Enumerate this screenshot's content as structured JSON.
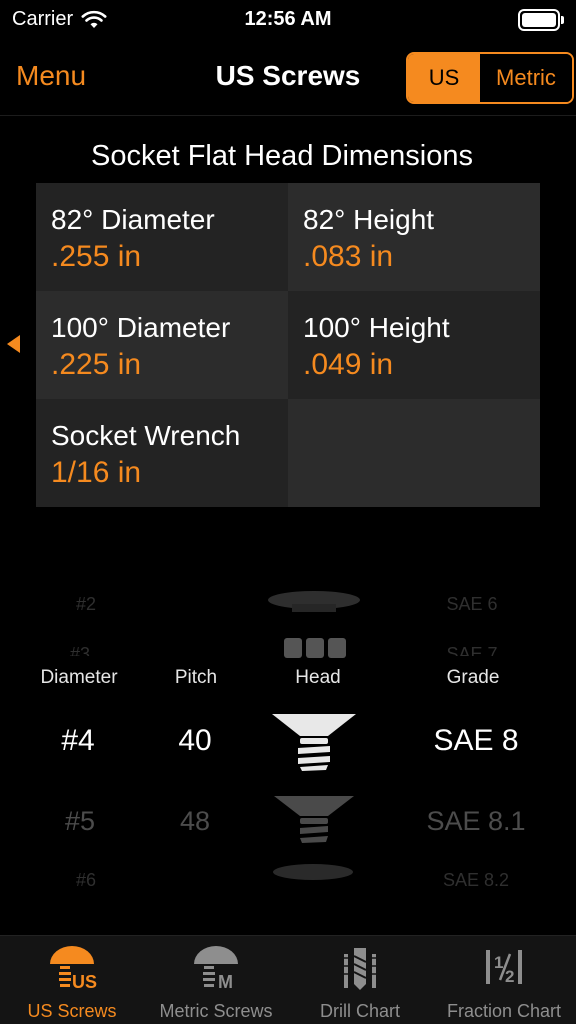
{
  "status_bar": {
    "carrier": "Carrier",
    "time": "12:56 AM"
  },
  "navbar": {
    "menu_label": "Menu",
    "title": "US Screws",
    "segments": [
      "US",
      "Metric"
    ],
    "selected_segment": "US"
  },
  "dimensions": {
    "title": "Socket Flat Head Dimensions",
    "cells": [
      {
        "label": "82° Diameter",
        "value": ".255 in"
      },
      {
        "label": "82° Height",
        "value": ".083 in"
      },
      {
        "label": "100° Diameter",
        "value": ".225 in"
      },
      {
        "label": "100° Height",
        "value": ".049 in"
      },
      {
        "label": "Socket Wrench",
        "value": "1/16 in"
      }
    ]
  },
  "picker": {
    "headers": {
      "diameter": "Diameter",
      "pitch": "Pitch",
      "head": "Head",
      "grade": "Grade"
    },
    "diameter": {
      "far_prev": "#2",
      "prev": "#3",
      "selected": "#4",
      "next": "#5",
      "far_next": "#6"
    },
    "pitch": {
      "selected": "40",
      "next": "48"
    },
    "grade": {
      "far_prev": "SAE 6",
      "prev": "SAE 7",
      "selected": "SAE 8",
      "next": "SAE 8.1",
      "far_next": "SAE 8.2"
    },
    "head_icons": [
      "button-head-icon",
      "socket-cap-icon",
      "flat-head-icon",
      "flat-head-icon",
      "pan-head-icon"
    ]
  },
  "tabbar": {
    "tabs": [
      {
        "label": "US Screws",
        "icon": "us-screw-icon",
        "active": true
      },
      {
        "label": "Metric Screws",
        "icon": "metric-screw-icon",
        "active": false
      },
      {
        "label": "Drill Chart",
        "icon": "drill-bit-icon",
        "active": false
      },
      {
        "label": "Fraction Chart",
        "icon": "fraction-icon",
        "active": false
      }
    ]
  },
  "colors": {
    "accent": "#f58a1f",
    "background": "#000000",
    "cell_dark": "#232323",
    "cell_mid": "#2c2c2c"
  }
}
